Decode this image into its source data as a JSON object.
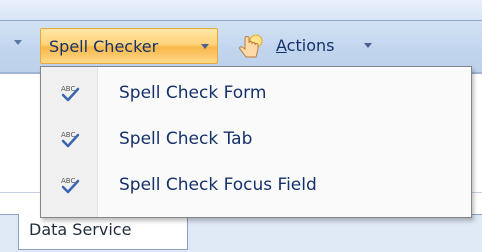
{
  "toolbar": {
    "spell_checker_label": "Spell Checker",
    "actions_label_accel": "A",
    "actions_label_rest": "ctions"
  },
  "menu": {
    "items": [
      {
        "label": "Spell Check Form",
        "icon": "spell-check-icon"
      },
      {
        "label": "Spell Check Tab",
        "icon": "spell-check-icon"
      },
      {
        "label": "Spell Check Focus Field",
        "icon": "spell-check-icon"
      }
    ]
  },
  "tabs": {
    "active_label": "Data Service"
  },
  "colors": {
    "accent_button": "#f8b84a",
    "menu_text": "#15316b",
    "toolbar_bg": "#cedff3"
  }
}
